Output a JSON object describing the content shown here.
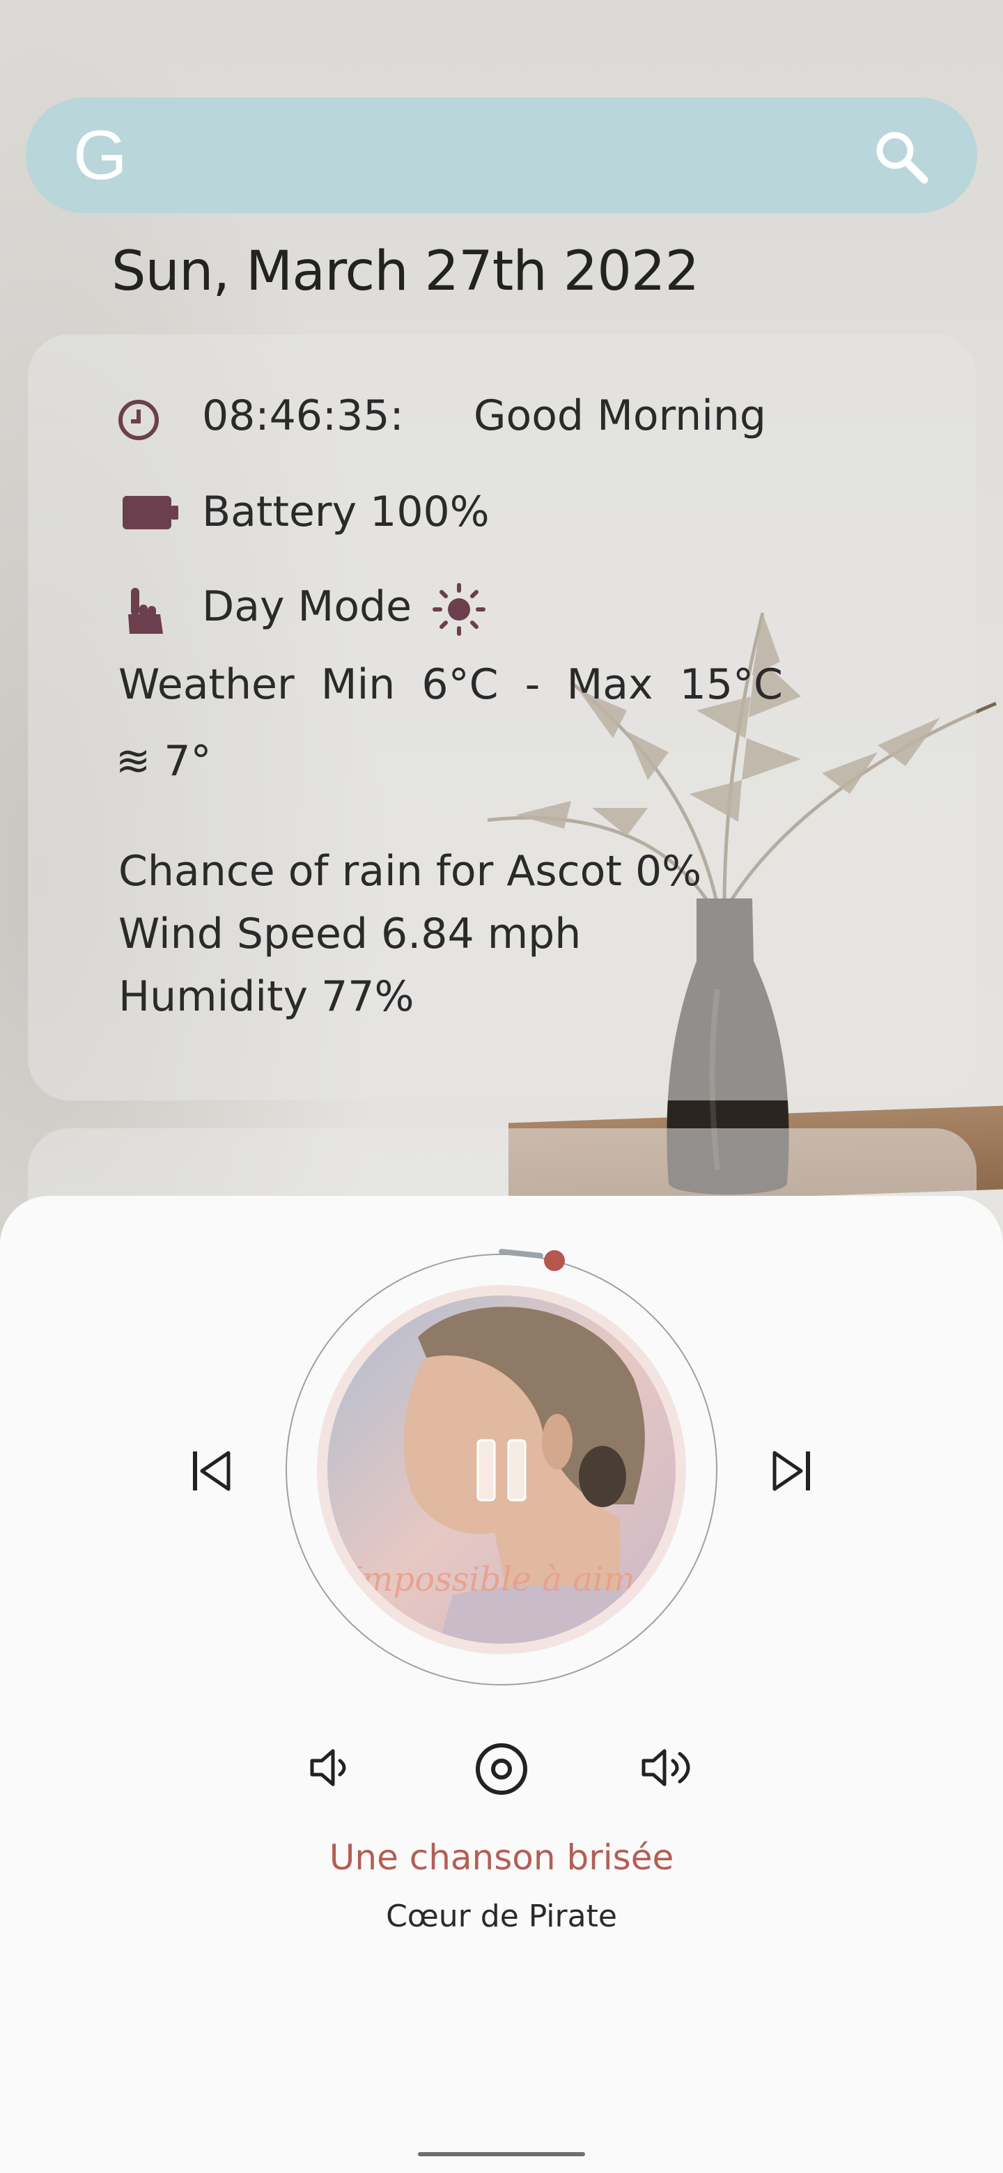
{
  "search": {
    "logo": "G",
    "icon": "search-icon"
  },
  "date": "Sun, March 27th 2022",
  "info": {
    "time": "08:46:35:",
    "greeting": "Good Morning",
    "battery": "Battery 100%",
    "mode": "Day Mode",
    "weather_label": "Weather",
    "min_label": "Min",
    "min_value": "6°C",
    "dash": "-",
    "max_label": "Max",
    "max_value": "15°C",
    "wind_dir_value": "7°",
    "rain": "Chance of rain for Ascot  0%",
    "wind": "Wind Speed  6.84 mph",
    "humidity": "Humidity  77%"
  },
  "player": {
    "title": "Une chanson brisée",
    "artist": "Cœur de Pirate",
    "album_art_text": "Impossible à aimer",
    "progress": 0.02
  },
  "colors": {
    "search_bg": "#b9d6da",
    "icon_maroon": "#6b3f4e",
    "accent": "#b45e55"
  }
}
